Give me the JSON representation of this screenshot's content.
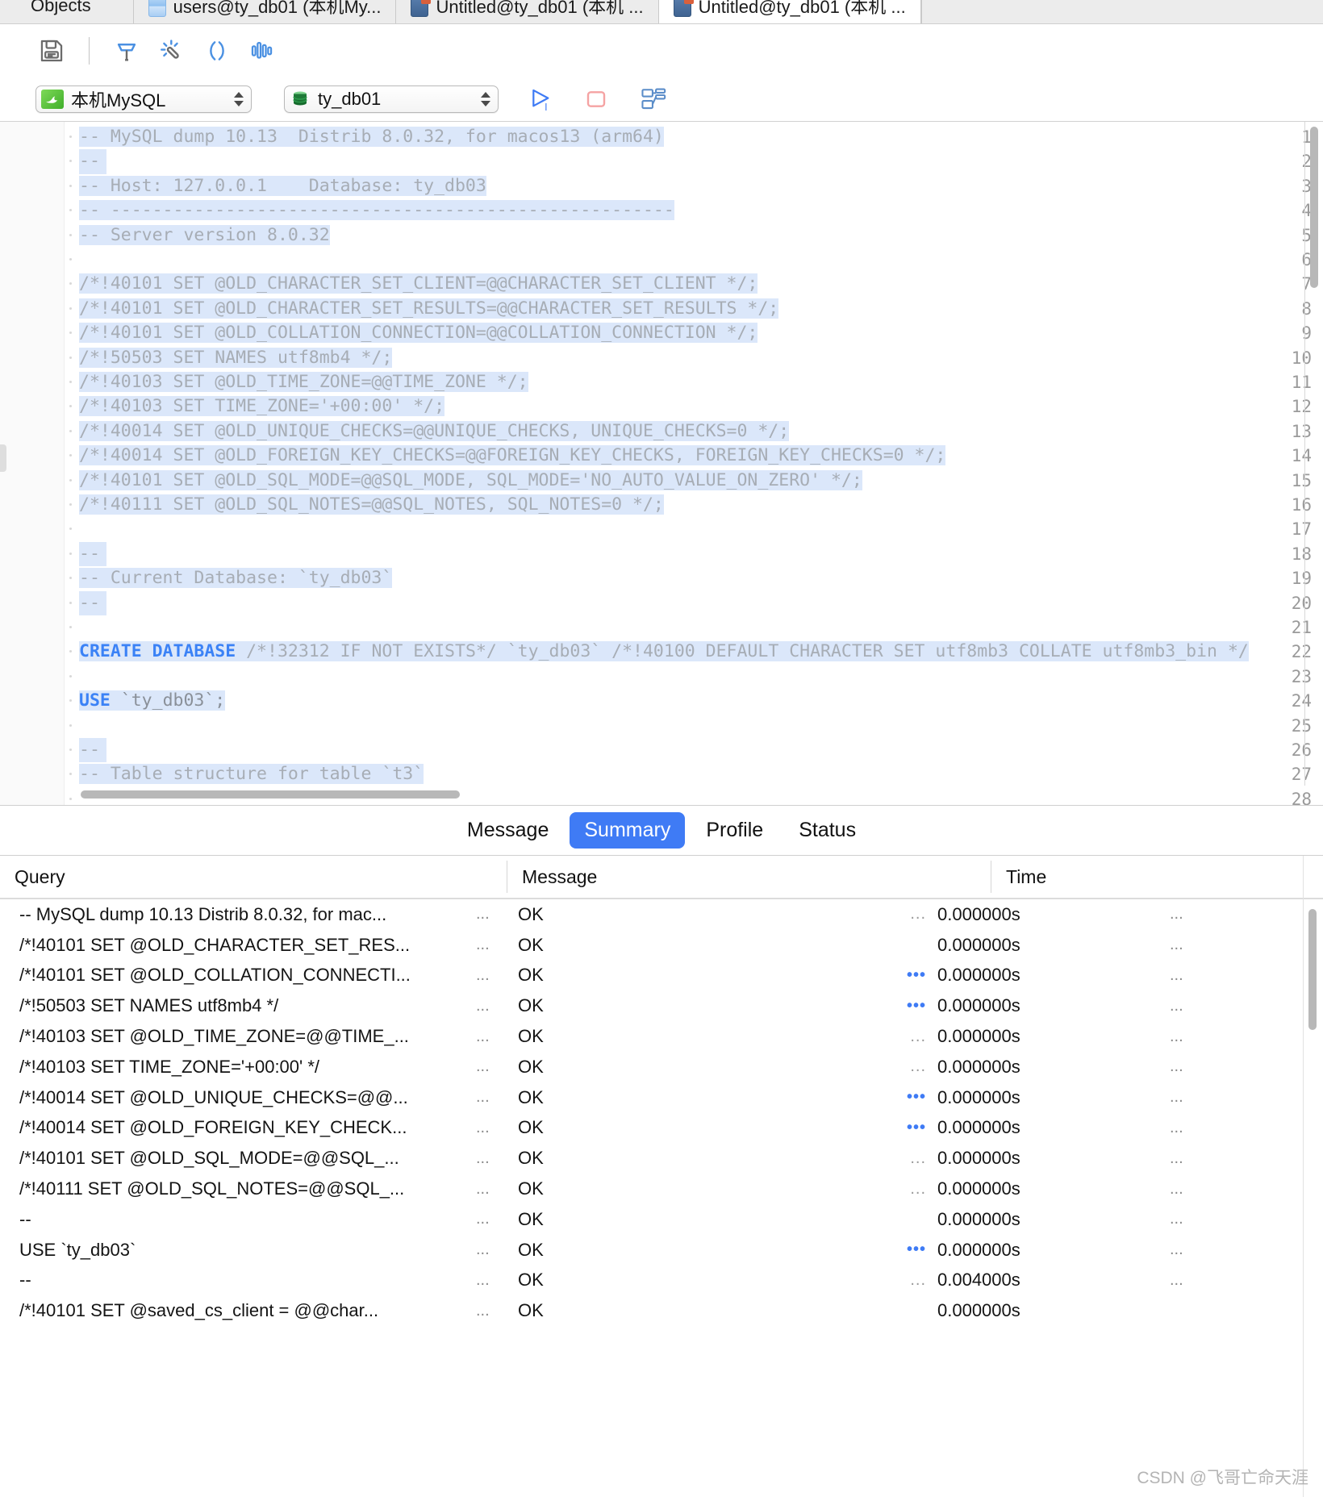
{
  "tabbar": {
    "tabs": [
      {
        "label": "Objects",
        "icon": "",
        "active": false
      },
      {
        "label": "users@ty_db01 (本机My...",
        "icon": "sheet-icon",
        "active": false
      },
      {
        "label": "Untitled@ty_db01 (本机 ...",
        "icon": "query-icon",
        "active": false
      },
      {
        "label": "Untitled@ty_db01 (本机 ...",
        "icon": "query-icon",
        "active": true
      }
    ]
  },
  "toolbar": {
    "buttons": [
      {
        "name": "save-icon",
        "title": "Save"
      },
      {
        "name": "beautify-icon",
        "title": "Beautify SQL"
      },
      {
        "name": "magic-wand-icon",
        "title": "Format"
      },
      {
        "name": "parentheses-icon",
        "title": "Code Snippet"
      },
      {
        "name": "explain-chart-icon",
        "title": "Explain"
      }
    ]
  },
  "selectors": {
    "connection": {
      "value": "本机MySQL",
      "icon": "mysql-dolphin-icon"
    },
    "database": {
      "value": "ty_db01",
      "icon": "database-cylinder-icon"
    },
    "run": {
      "name": "run-icon"
    },
    "stop": {
      "name": "stop-icon"
    },
    "explain": {
      "name": "explain-plan-icon"
    }
  },
  "editor": {
    "line_count": 28,
    "lines": [
      {
        "n": 1,
        "segments": [
          {
            "t": "-- MySQL dump 10.13  Distrib 8.0.32, for macos13 (arm64)",
            "c": "cm"
          }
        ],
        "hl": true
      },
      {
        "n": 2,
        "segments": [
          {
            "t": "--",
            "c": "cm"
          }
        ],
        "hl": true,
        "hlw": 34
      },
      {
        "n": 3,
        "segments": [
          {
            "t": "-- Host: 127.0.0.1    Database: ty_db03",
            "c": "cm"
          }
        ],
        "hl": true
      },
      {
        "n": 4,
        "segments": [
          {
            "t": "-- ------------------------------------------------------",
            "c": "cm"
          }
        ],
        "hl": true
      },
      {
        "n": 5,
        "segments": [
          {
            "t": "-- Server version 8.0.32",
            "c": "cm"
          }
        ],
        "hl": true
      },
      {
        "n": 6,
        "segments": [
          {
            "t": "",
            "c": "cm"
          }
        ],
        "hl": true,
        "hlw": 34
      },
      {
        "n": 7,
        "segments": [
          {
            "t": "/*!40101 SET @OLD_CHARACTER_SET_CLIENT=@@CHARACTER_SET_CLIENT */;",
            "c": "cm"
          }
        ],
        "hl": true
      },
      {
        "n": 8,
        "segments": [
          {
            "t": "/*!40101 SET @OLD_CHARACTER_SET_RESULTS=@@CHARACTER_SET_RESULTS */;",
            "c": "cm"
          }
        ],
        "hl": true
      },
      {
        "n": 9,
        "segments": [
          {
            "t": "/*!40101 SET @OLD_COLLATION_CONNECTION=@@COLLATION_CONNECTION */;",
            "c": "cm"
          }
        ],
        "hl": true
      },
      {
        "n": 10,
        "segments": [
          {
            "t": "/*!50503 SET NAMES utf8mb4 */;",
            "c": "cm"
          }
        ],
        "hl": true
      },
      {
        "n": 11,
        "segments": [
          {
            "t": "/*!40103 SET @OLD_TIME_ZONE=@@TIME_ZONE */;",
            "c": "cm"
          }
        ],
        "hl": true
      },
      {
        "n": 12,
        "segments": [
          {
            "t": "/*!40103 SET TIME_ZONE='+00:00' */;",
            "c": "cm"
          }
        ],
        "hl": true
      },
      {
        "n": 13,
        "segments": [
          {
            "t": "/*!40014 SET @OLD_UNIQUE_CHECKS=@@UNIQUE_CHECKS, UNIQUE_CHECKS=0 */;",
            "c": "cm"
          }
        ],
        "hl": true
      },
      {
        "n": 14,
        "segments": [
          {
            "t": "/*!40014 SET @OLD_FOREIGN_KEY_CHECKS=@@FOREIGN_KEY_CHECKS, FOREIGN_KEY_CHECKS=0 */;",
            "c": "cm"
          }
        ],
        "hl": true
      },
      {
        "n": 15,
        "segments": [
          {
            "t": "/*!40101 SET @OLD_SQL_MODE=@@SQL_MODE, SQL_MODE='NO_AUTO_VALUE_ON_ZERO' */;",
            "c": "cm"
          }
        ],
        "hl": true
      },
      {
        "n": 16,
        "segments": [
          {
            "t": "/*!40111 SET @OLD_SQL_NOTES=@@SQL_NOTES, SQL_NOTES=0 */;",
            "c": "cm"
          }
        ],
        "hl": true
      },
      {
        "n": 17,
        "segments": [
          {
            "t": "",
            "c": "cm"
          }
        ],
        "hl": true,
        "hlw": 34
      },
      {
        "n": 18,
        "segments": [
          {
            "t": "--",
            "c": "cm"
          }
        ],
        "hl": true,
        "hlw": 34
      },
      {
        "n": 19,
        "segments": [
          {
            "t": "-- Current Database: `ty_db03`",
            "c": "cm"
          }
        ],
        "hl": true
      },
      {
        "n": 20,
        "segments": [
          {
            "t": "--",
            "c": "cm"
          }
        ],
        "hl": true,
        "hlw": 34
      },
      {
        "n": 21,
        "segments": [
          {
            "t": "",
            "c": "cm"
          }
        ],
        "hl": true,
        "hlw": 34
      },
      {
        "n": 22,
        "segments": [
          {
            "t": "CREATE DATABASE",
            "c": "kw"
          },
          {
            "t": " /*!32312 IF NOT EXISTS*/ `ty_db03` /*!40100 DEFAULT CHARACTER SET utf8mb3 COLLATE utf8mb3_bin */",
            "c": "cm"
          }
        ],
        "hl": true
      },
      {
        "n": 23,
        "segments": [
          {
            "t": "",
            "c": "cm"
          }
        ],
        "hl": true,
        "hlw": 34
      },
      {
        "n": 24,
        "segments": [
          {
            "t": "USE",
            "c": "kw"
          },
          {
            "t": " `ty_db03`;",
            "c": "pln"
          }
        ],
        "hl": true
      },
      {
        "n": 25,
        "segments": [
          {
            "t": "",
            "c": "cm"
          }
        ],
        "hl": true,
        "hlw": 34
      },
      {
        "n": 26,
        "segments": [
          {
            "t": "--",
            "c": "cm"
          }
        ],
        "hl": true,
        "hlw": 34
      },
      {
        "n": 27,
        "segments": [
          {
            "t": "-- Table structure for table `t3`",
            "c": "cm"
          }
        ],
        "hl": true
      },
      {
        "n": 28,
        "segments": [
          {
            "t": "",
            "c": "cm"
          }
        ],
        "hl": false
      }
    ]
  },
  "result_tabs": {
    "items": [
      {
        "label": "Message",
        "active": false
      },
      {
        "label": "Summary",
        "active": true
      },
      {
        "label": "Profile",
        "active": false
      },
      {
        "label": "Status",
        "active": false
      }
    ],
    "active_color": "#3f7bf5"
  },
  "result_table": {
    "columns": [
      "Query",
      "Message",
      "Time"
    ],
    "rows": [
      {
        "query": "-- MySQL dump 10.13  Distrib 8.0.32, for mac...",
        "q_ell": "...",
        "message": "OK",
        "dots": "...",
        "dots_style": "grey",
        "time": "0.000000s",
        "row_ell": "..."
      },
      {
        "query": "/*!40101 SET @OLD_CHARACTER_SET_RES...",
        "q_ell": "...",
        "message": "OK",
        "dots": "",
        "dots_style": "grey",
        "time": "0.000000s",
        "row_ell": "..."
      },
      {
        "query": "/*!40101 SET @OLD_COLLATION_CONNECTI...",
        "q_ell": "...",
        "message": "OK",
        "dots": "•••",
        "dots_style": "blue",
        "time": "0.000000s",
        "row_ell": "..."
      },
      {
        "query": "/*!50503 SET NAMES utf8mb4 */",
        "q_ell": "...",
        "message": "OK",
        "dots": "•••",
        "dots_style": "blue",
        "time": "0.000000s",
        "row_ell": "..."
      },
      {
        "query": "/*!40103 SET @OLD_TIME_ZONE=@@TIME_...",
        "q_ell": "...",
        "message": "OK",
        "dots": "...",
        "dots_style": "grey",
        "time": "0.000000s",
        "row_ell": "..."
      },
      {
        "query": "/*!40103 SET TIME_ZONE='+00:00' */",
        "q_ell": "...",
        "message": "OK",
        "dots": "...",
        "dots_style": "grey",
        "time": "0.000000s",
        "row_ell": "..."
      },
      {
        "query": "/*!40014 SET @OLD_UNIQUE_CHECKS=@@...",
        "q_ell": "...",
        "message": "OK",
        "dots": "•••",
        "dots_style": "blue",
        "time": "0.000000s",
        "row_ell": "..."
      },
      {
        "query": "/*!40014 SET @OLD_FOREIGN_KEY_CHECK...",
        "q_ell": "...",
        "message": "OK",
        "dots": "•••",
        "dots_style": "blue",
        "time": "0.000000s",
        "row_ell": "..."
      },
      {
        "query": "/*!40101 SET @OLD_SQL_MODE=@@SQL_...",
        "q_ell": "...",
        "message": "OK",
        "dots": "...",
        "dots_style": "grey",
        "time": "0.000000s",
        "row_ell": "..."
      },
      {
        "query": "/*!40111 SET @OLD_SQL_NOTES=@@SQL_...",
        "q_ell": "...",
        "message": "OK",
        "dots": "...",
        "dots_style": "grey",
        "time": "0.000000s",
        "row_ell": "..."
      },
      {
        "query": "--",
        "q_ell": "...",
        "message": "OK",
        "dots": "",
        "dots_style": "grey",
        "time": "0.000000s",
        "row_ell": "..."
      },
      {
        "query": "USE `ty_db03`",
        "q_ell": "...",
        "message": "OK",
        "dots": "•••",
        "dots_style": "blue",
        "time": "0.000000s",
        "row_ell": "..."
      },
      {
        "query": "--",
        "q_ell": "...",
        "message": "OK",
        "dots": "...",
        "dots_style": "grey",
        "time": "0.004000s",
        "row_ell": "..."
      },
      {
        "query": "/*!40101 SET @saved_cs_client     = @@char...",
        "q_ell": "...",
        "message": "OK",
        "dots": "",
        "dots_style": "grey",
        "time": "0.000000s",
        "row_ell": ""
      }
    ]
  },
  "watermark": {
    "text": "CSDN @飞哥亡命天涯"
  }
}
